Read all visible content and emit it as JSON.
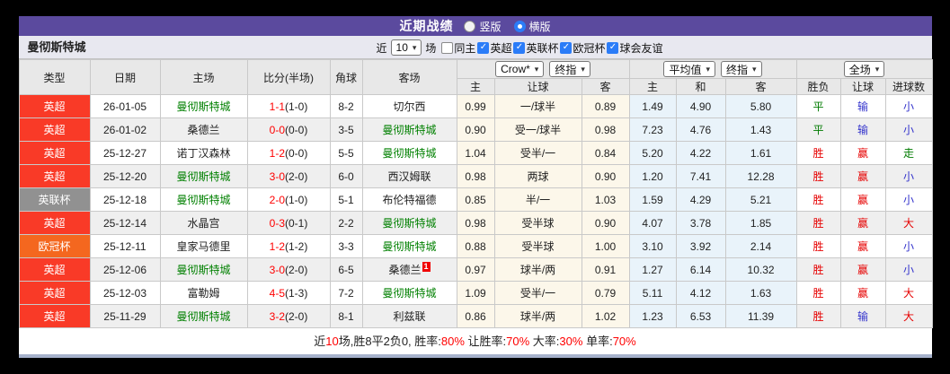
{
  "title_bar": {
    "title": "近期战绩",
    "radios": [
      {
        "key": "vertical",
        "label": "竖版",
        "selected": false
      },
      {
        "key": "horizontal",
        "label": "横版",
        "selected": true
      }
    ]
  },
  "filter_bar": {
    "team_name": "曼彻斯特城",
    "recent_label": "近",
    "recent_count": "10",
    "games_label": "场",
    "checkboxes": [
      {
        "key": "same-home",
        "label": "同主",
        "checked": false
      },
      {
        "key": "epl",
        "label": "英超",
        "checked": true
      },
      {
        "key": "efl-cup",
        "label": "英联杯",
        "checked": true
      },
      {
        "key": "ucl",
        "label": "欧冠杯",
        "checked": true
      },
      {
        "key": "friendly",
        "label": "球会友谊",
        "checked": true
      }
    ]
  },
  "table": {
    "left_headers": [
      "类型",
      "日期",
      "主场",
      "比分(半场)",
      "角球",
      "客场"
    ],
    "dropdown_groups": {
      "asia": [
        "Crow*",
        "终指"
      ],
      "europe": [
        "平均值",
        "终指"
      ],
      "result": [
        "全场"
      ]
    },
    "sub_headers": [
      "主",
      "让球",
      "客",
      "主",
      "和",
      "客",
      "胜负",
      "让球",
      "进球数"
    ],
    "rows": [
      {
        "league": "英超",
        "date": "26-01-05",
        "home": "曼彻斯特城",
        "home_self": true,
        "score": "1-1",
        "half": "(1-0)",
        "corner": "8-2",
        "away": "切尔西",
        "away_self": false,
        "away_mark": "",
        "asia_home": "0.99",
        "handicap": "一/球半",
        "asia_away": "0.89",
        "eu_home": "1.49",
        "eu_draw": "4.90",
        "eu_away": "5.80",
        "result": "平",
        "handicap_result": "输",
        "goals": "小"
      },
      {
        "league": "英超",
        "date": "26-01-02",
        "home": "桑德兰",
        "home_self": false,
        "score": "0-0",
        "half": "(0-0)",
        "corner": "3-5",
        "away": "曼彻斯特城",
        "away_self": true,
        "away_mark": "",
        "asia_home": "0.90",
        "handicap": "受一/球半",
        "asia_away": "0.98",
        "eu_home": "7.23",
        "eu_draw": "4.76",
        "eu_away": "1.43",
        "result": "平",
        "handicap_result": "输",
        "goals": "小"
      },
      {
        "league": "英超",
        "date": "25-12-27",
        "home": "诺丁汉森林",
        "home_self": false,
        "score": "1-2",
        "half": "(0-0)",
        "corner": "5-5",
        "away": "曼彻斯特城",
        "away_self": true,
        "away_mark": "",
        "asia_home": "1.04",
        "handicap": "受半/一",
        "asia_away": "0.84",
        "eu_home": "5.20",
        "eu_draw": "4.22",
        "eu_away": "1.61",
        "result": "胜",
        "handicap_result": "赢",
        "goals": "走"
      },
      {
        "league": "英超",
        "date": "25-12-20",
        "home": "曼彻斯特城",
        "home_self": true,
        "score": "3-0",
        "half": "(2-0)",
        "corner": "6-0",
        "away": "西汉姆联",
        "away_self": false,
        "away_mark": "",
        "asia_home": "0.98",
        "handicap": "两球",
        "asia_away": "0.90",
        "eu_home": "1.20",
        "eu_draw": "7.41",
        "eu_away": "12.28",
        "result": "胜",
        "handicap_result": "赢",
        "goals": "小"
      },
      {
        "league": "英联杯",
        "date": "25-12-18",
        "home": "曼彻斯特城",
        "home_self": true,
        "score": "2-0",
        "half": "(1-0)",
        "corner": "5-1",
        "away": "布伦特福德",
        "away_self": false,
        "away_mark": "",
        "asia_home": "0.85",
        "handicap": "半/一",
        "asia_away": "1.03",
        "eu_home": "1.59",
        "eu_draw": "4.29",
        "eu_away": "5.21",
        "result": "胜",
        "handicap_result": "赢",
        "goals": "小"
      },
      {
        "league": "英超",
        "date": "25-12-14",
        "home": "水晶宫",
        "home_self": false,
        "score": "0-3",
        "half": "(0-1)",
        "corner": "2-2",
        "away": "曼彻斯特城",
        "away_self": true,
        "away_mark": "",
        "asia_home": "0.98",
        "handicap": "受半球",
        "asia_away": "0.90",
        "eu_home": "4.07",
        "eu_draw": "3.78",
        "eu_away": "1.85",
        "result": "胜",
        "handicap_result": "赢",
        "goals": "大"
      },
      {
        "league": "欧冠杯",
        "date": "25-12-11",
        "home": "皇家马德里",
        "home_self": false,
        "score": "1-2",
        "half": "(1-2)",
        "corner": "3-3",
        "away": "曼彻斯特城",
        "away_self": true,
        "away_mark": "",
        "asia_home": "0.88",
        "handicap": "受半球",
        "asia_away": "1.00",
        "eu_home": "3.10",
        "eu_draw": "3.92",
        "eu_away": "2.14",
        "result": "胜",
        "handicap_result": "赢",
        "goals": "小"
      },
      {
        "league": "英超",
        "date": "25-12-06",
        "home": "曼彻斯特城",
        "home_self": true,
        "score": "3-0",
        "half": "(2-0)",
        "corner": "6-5",
        "away": "桑德兰",
        "away_self": false,
        "away_mark": "1",
        "asia_home": "0.97",
        "handicap": "球半/两",
        "asia_away": "0.91",
        "eu_home": "1.27",
        "eu_draw": "6.14",
        "eu_away": "10.32",
        "result": "胜",
        "handicap_result": "赢",
        "goals": "小"
      },
      {
        "league": "英超",
        "date": "25-12-03",
        "home": "富勒姆",
        "home_self": false,
        "score": "4-5",
        "half": "(1-3)",
        "corner": "7-2",
        "away": "曼彻斯特城",
        "away_self": true,
        "away_mark": "",
        "asia_home": "1.09",
        "handicap": "受半/一",
        "asia_away": "0.79",
        "eu_home": "5.11",
        "eu_draw": "4.12",
        "eu_away": "1.63",
        "result": "胜",
        "handicap_result": "赢",
        "goals": "大"
      },
      {
        "league": "英超",
        "date": "25-11-29",
        "home": "曼彻斯特城",
        "home_self": true,
        "score": "3-2",
        "half": "(2-0)",
        "corner": "8-1",
        "away": "利兹联",
        "away_self": false,
        "away_mark": "",
        "asia_home": "0.86",
        "handicap": "球半/两",
        "asia_away": "1.02",
        "eu_home": "1.23",
        "eu_draw": "6.53",
        "eu_away": "11.39",
        "result": "胜",
        "handicap_result": "输",
        "goals": "大"
      }
    ]
  },
  "footer": {
    "segments": [
      {
        "text": "近",
        "red": false
      },
      {
        "text": "10",
        "red": true
      },
      {
        "text": "场,胜8平2负0, 胜率:",
        "red": false
      },
      {
        "text": "80%",
        "red": true
      },
      {
        "text": " 让胜率:",
        "red": false
      },
      {
        "text": "70%",
        "red": true
      },
      {
        "text": " 大率:",
        "red": false
      },
      {
        "text": "30%",
        "red": true
      },
      {
        "text": " 单率:",
        "red": false
      },
      {
        "text": "70%",
        "red": true
      }
    ]
  },
  "colors": {
    "bar_purple": "#5b4a9e",
    "accent_blue": "#2b7cf8",
    "self_team_green": "#008000",
    "score_red": "#ff0000",
    "league": {
      "英超": "#f93a27",
      "英联杯": "#919191",
      "欧冠杯": "#f4671f"
    },
    "verdict": {
      "胜": "#e60000",
      "平": "#007b00",
      "负": "#3333cc",
      "赢": "#e60000",
      "输": "#3333cc",
      "走": "#007b00",
      "大": "#e60000",
      "小": "#3333cc"
    }
  }
}
